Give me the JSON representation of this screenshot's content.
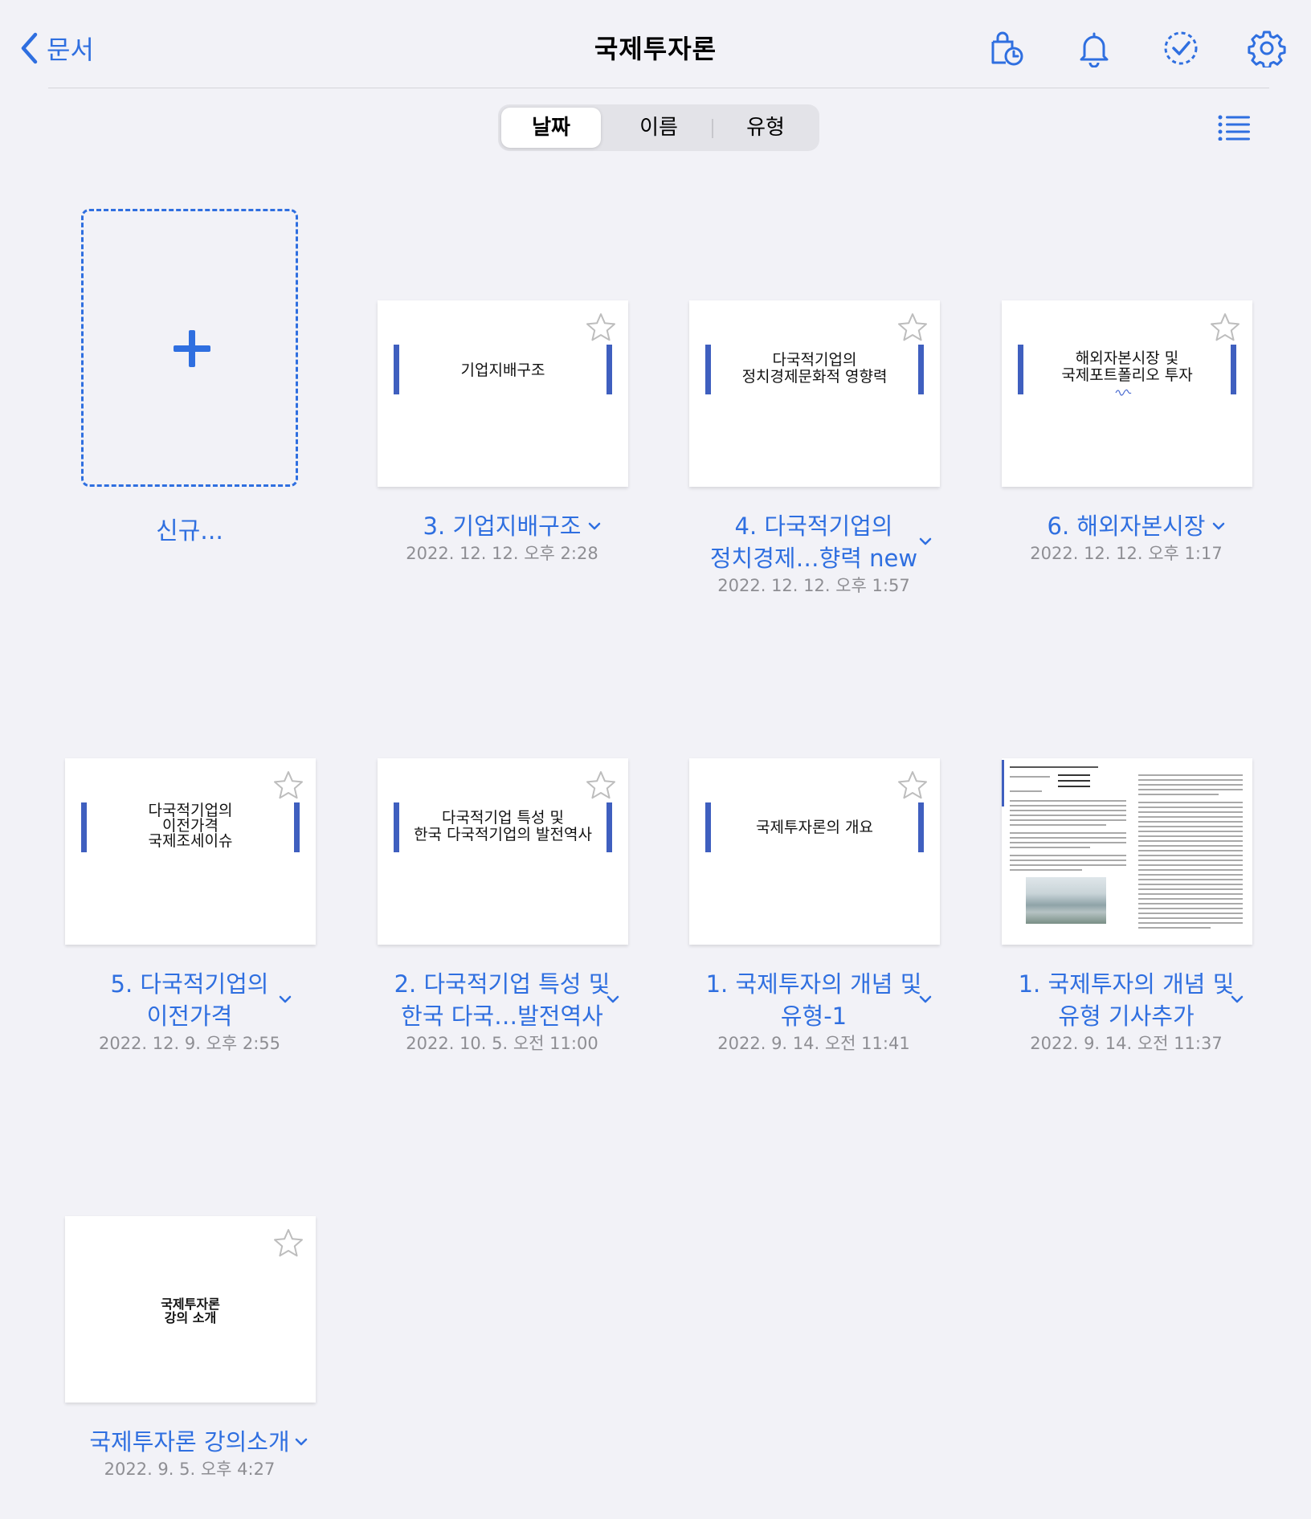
{
  "header": {
    "back_label": "문서",
    "title": "국제투자론",
    "icons": [
      "bag-clock-icon",
      "bell-icon",
      "check-circle-icon",
      "gear-icon"
    ]
  },
  "sort": {
    "options": [
      "날짜",
      "이름",
      "유형"
    ],
    "selected": "날짜"
  },
  "new_doc_label": "신규...",
  "documents": [
    {
      "title_lines": [
        "3. 기업지배구조"
      ],
      "date": "2022. 12. 12. 오후 2:28",
      "thumb_lines": [
        "기업지배구조"
      ]
    },
    {
      "title_lines": [
        "4. 다국적기업의",
        "정치경제…향력 new"
      ],
      "date": "2022. 12. 12. 오후 1:57",
      "thumb_lines": [
        "다국적기업의",
        "정치경제문화적 영향력"
      ]
    },
    {
      "title_lines": [
        "6. 해외자본시장"
      ],
      "date": "2022. 12. 12. 오후 1:17",
      "thumb_lines": [
        "해외자본시장 및",
        "국제포트폴리오 투자"
      ]
    },
    {
      "title_lines": [
        "5. 다국적기업의",
        "이전가격"
      ],
      "date": "2022. 12. 9. 오후 2:55",
      "thumb_lines": [
        "다국적기업의",
        "이전가격",
        "국제조세이슈"
      ]
    },
    {
      "title_lines": [
        "2. 다국적기업 특성 및",
        "한국 다국…발전역사"
      ],
      "date": "2022. 10. 5. 오전 11:00",
      "thumb_lines": [
        "다국적기업 특성 및",
        "한국 다국적기업의 발전역사"
      ]
    },
    {
      "title_lines": [
        "1. 국제투자의 개념 및",
        "유형-1"
      ],
      "date": "2022. 9. 14. 오전 11:41",
      "thumb_lines": [
        "국제투자론의 개요"
      ]
    },
    {
      "title_lines": [
        "1. 국제투자의 개념 및",
        "유형 기사추가"
      ],
      "date": "2022. 9. 14. 오전 11:37",
      "thumb_lines": []
    },
    {
      "title_lines": [
        "국제투자론 강의소개"
      ],
      "date": "2022. 9. 5. 오후 4:27",
      "thumb_lines": [
        "국제투자론",
        "강의 소개"
      ]
    }
  ],
  "colors": {
    "accent": "#2f6fe0",
    "background": "#f2f2f7",
    "slide_bar": "#3f5fbf"
  }
}
